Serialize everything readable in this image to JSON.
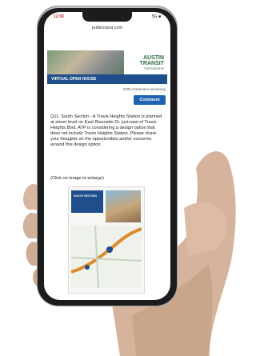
{
  "status_bar": {
    "left": "12:00",
    "right": "5G ■"
  },
  "browser": {
    "url": "publicinput.com"
  },
  "banner": {
    "logo_line1": "AUSTIN",
    "logo_line2": "TRANSIT",
    "logo_sub": "PARTNERSHIP",
    "strip_label": "VIRTUAL OPEN HOUSE"
  },
  "form": {
    "chars_remaining": "2000 characters remaining",
    "comment_button": "Comment"
  },
  "question": {
    "text": "Q11: South Section - A Travis Heights Station is planned at street level on East Riverside Dr. just east of Travis Heights Blvd. ATP is considering a design option that does not include Travis Heights Station. Please share your thoughts on the opportunities and/or concerns around this design option.",
    "enlarge_note": "(Click on image to enlarge)"
  },
  "doc_image": {
    "header": "SOUTH SECTION"
  }
}
